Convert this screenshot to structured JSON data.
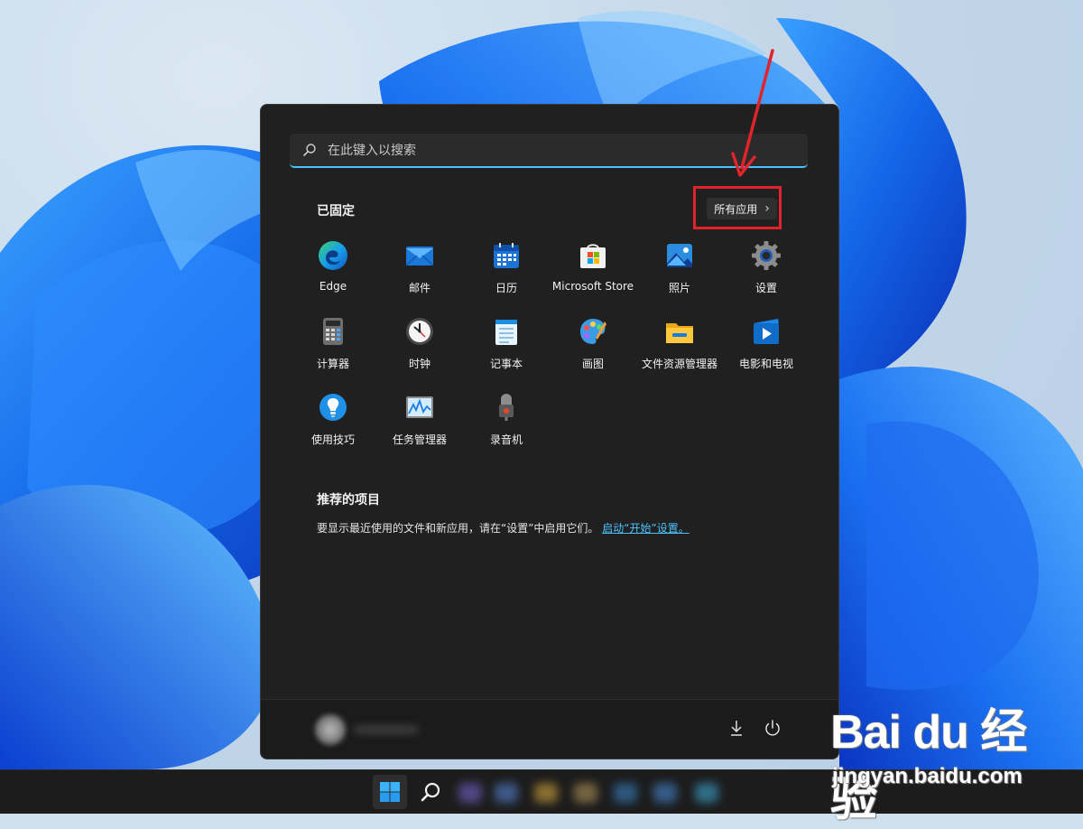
{
  "search": {
    "placeholder": "在此键入以搜索"
  },
  "pinned": {
    "title": "已固定",
    "all_apps_label": "所有应用",
    "all_apps_chevron": "›",
    "apps": [
      {
        "label": "Edge",
        "icon": "edge-icon"
      },
      {
        "label": "邮件",
        "icon": "mail-icon"
      },
      {
        "label": "日历",
        "icon": "calendar-icon"
      },
      {
        "label": "Microsoft Store",
        "icon": "store-icon"
      },
      {
        "label": "照片",
        "icon": "photos-icon"
      },
      {
        "label": "设置",
        "icon": "settings-icon"
      },
      {
        "label": "计算器",
        "icon": "calculator-icon"
      },
      {
        "label": "时钟",
        "icon": "clock-icon"
      },
      {
        "label": "记事本",
        "icon": "notepad-icon"
      },
      {
        "label": "画图",
        "icon": "paint-icon"
      },
      {
        "label": "文件资源管理器",
        "icon": "folder-icon"
      },
      {
        "label": "电影和电视",
        "icon": "movies-icon"
      },
      {
        "label": "使用技巧",
        "icon": "tips-icon"
      },
      {
        "label": "任务管理器",
        "icon": "task-manager-icon"
      },
      {
        "label": "录音机",
        "icon": "recorder-icon"
      }
    ]
  },
  "recommended": {
    "title": "推荐的项目",
    "message": "要显示最近使用的文件和新应用，请在“设置”中启用它们。",
    "link": "启动“开始”设置。"
  },
  "watermark": {
    "logo": "Bai du 经验",
    "url": "jingyan.baidu.com"
  },
  "colors": {
    "accent": "#4cc2ff",
    "highlight": "#e0242a",
    "panel": "#202020"
  }
}
